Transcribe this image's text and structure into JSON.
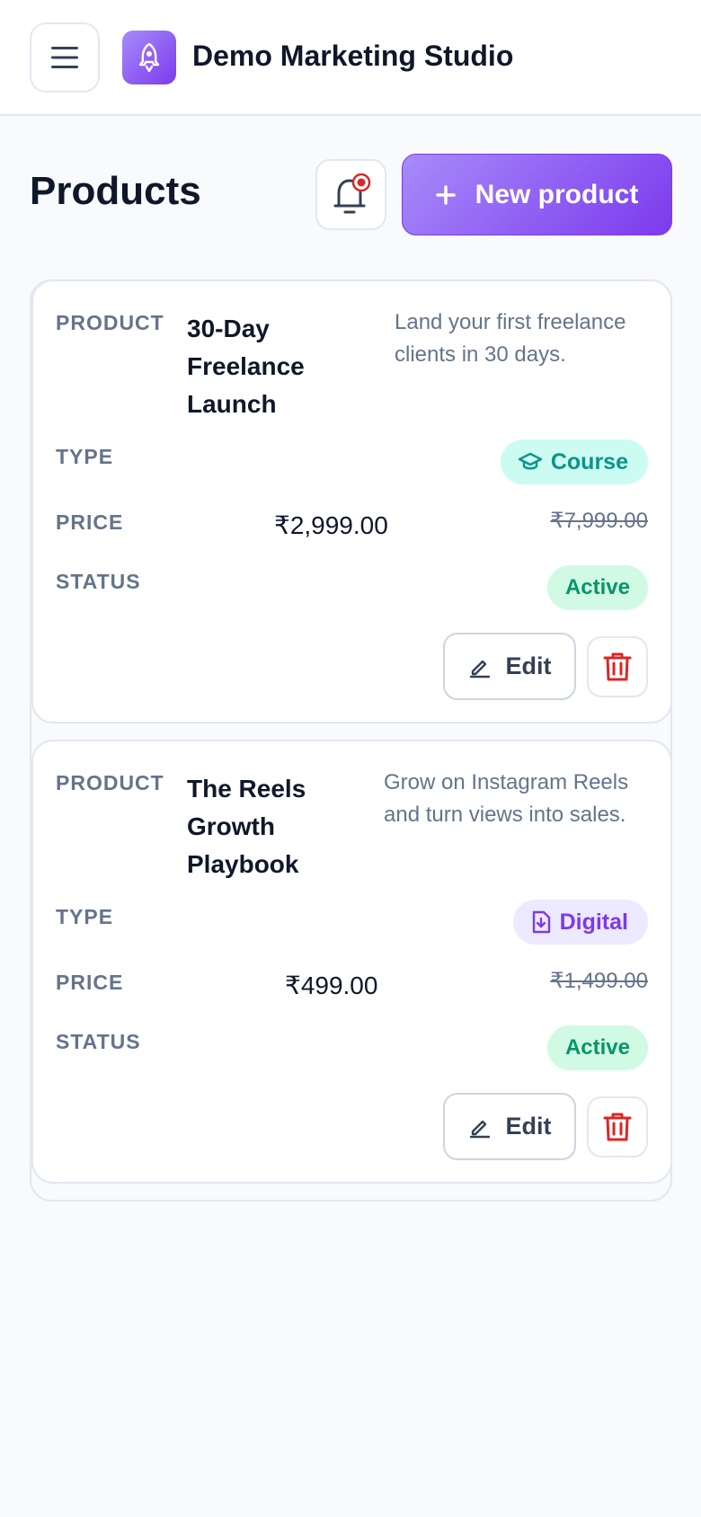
{
  "header": {
    "brand_name": "Demo Marketing Studio"
  },
  "page": {
    "title": "Products",
    "new_product_label": "New product"
  },
  "labels": {
    "product": "PRODUCT",
    "type": "TYPE",
    "price": "PRICE",
    "status": "STATUS",
    "edit": "Edit"
  },
  "products": [
    {
      "name": "30-Day Freelance Launch",
      "description": "Land your first freelance clients in 30 days.",
      "type": "Course",
      "type_color": "#0d9488",
      "type_bg": "#ccfbf1",
      "type_icon": "graduation-cap-icon",
      "price": "₹2,999.00",
      "original_price": "₹7,999.00",
      "status": "Active"
    },
    {
      "name": "The Reels Growth Playbook",
      "description": "Grow on Instagram Reels and turn views into sales.",
      "type": "Digital",
      "type_color": "#7c3aed",
      "type_bg": "#ede9fe",
      "type_icon": "file-download-icon",
      "price": "₹499.00",
      "original_price": "₹1,499.00",
      "status": "Active"
    }
  ],
  "colors": {
    "accent": "#7c3aed",
    "danger": "#dc2626",
    "notification_dot": "#dc2626"
  }
}
